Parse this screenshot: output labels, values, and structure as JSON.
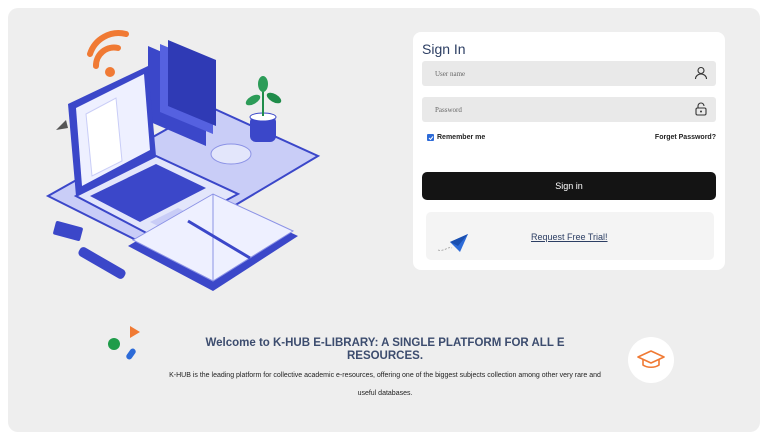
{
  "signin": {
    "title": "Sign In",
    "username_placeholder": "User name",
    "password_placeholder": "Password",
    "remember_label": "Remember me",
    "remember_checked": true,
    "forgot_label": "Forget Password?",
    "button_label": "Sign in",
    "trial_label": "Request Free Trial!"
  },
  "welcome": {
    "title": "Welcome to K-HUB E-LIBRARY: A SINGLE PLATFORM FOR ALL E RESOURCES.",
    "description": "K-HUB is the leading platform for collective academic e-resources, offering one of the biggest subjects collection among other very rare and useful databases."
  },
  "icons": {
    "username": "user-icon",
    "password": "lock-icon",
    "trial": "paper-plane-icon",
    "cap": "graduation-cap-icon"
  },
  "colors": {
    "accent_blue": "#3b47c9",
    "button": "#141414",
    "checkbox": "#2d6bd8",
    "title_text": "#2c3e63",
    "orange": "#f07a34"
  }
}
